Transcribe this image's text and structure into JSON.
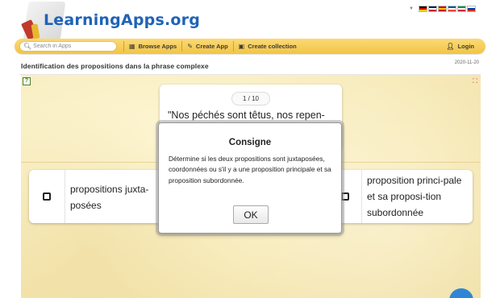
{
  "header": {
    "logo_text": "LearningApps.org",
    "flag_colors": [
      [
        "#000000",
        "#dd0000",
        "#ffce00"
      ],
      [
        "#012169",
        "#ffffff",
        "#c8102e"
      ],
      [
        "#c60b1e",
        "#ffc400",
        "#c60b1e"
      ],
      [
        "#0055a4",
        "#ffffff",
        "#ef4135"
      ],
      [
        "#009246",
        "#ffffff",
        "#ce2b37"
      ],
      [
        "#ffffff",
        "#0039a6",
        "#d52b1e"
      ]
    ]
  },
  "toolbar": {
    "search_placeholder": "Search in Apps",
    "browse_label": "Browse Apps",
    "create_app_label": "Create App",
    "create_collection_label": "Create collection",
    "login_label": "Login"
  },
  "page": {
    "title": "Identification des propositions dans la phrase complexe",
    "date": "2020-11-20"
  },
  "exercise": {
    "counter": "1 / 10",
    "question_text": "\"Nos péchés sont têtus, nos repen-",
    "option_left": "propositions juxta-posées",
    "option_right": "proposition princi-pale et sa proposi-tion subordonnée"
  },
  "modal": {
    "title": "Consigne",
    "body": "Détermine si les deux propositions sont juxtaposées, coordonnées ou s'il y a une proposition principale et sa proposition subordonnée.",
    "ok_label": "OK"
  },
  "colors": {
    "toolbar": "#f2c444",
    "logo": "#1f63b7",
    "app_background": "#f8ecbd",
    "fab": "#2f86d6"
  }
}
